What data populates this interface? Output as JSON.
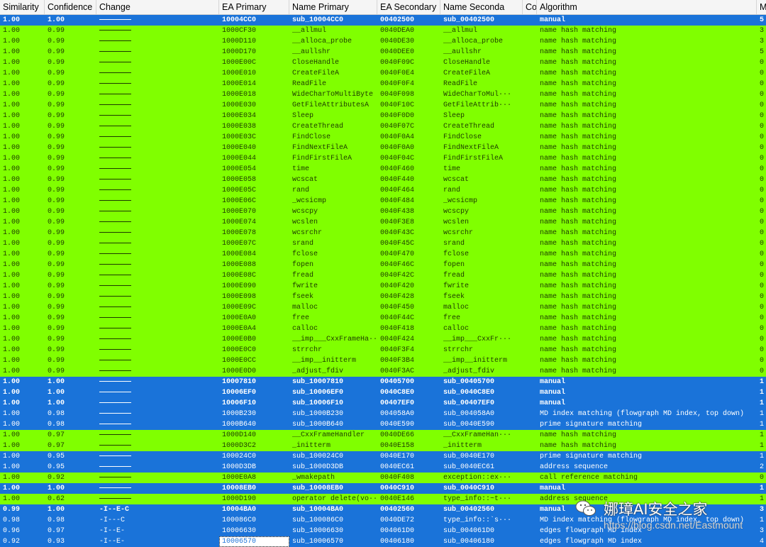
{
  "colors": {
    "green": "#80ff00",
    "blue": "#1a73d9",
    "header": "#f5f5f5"
  },
  "columns": [
    "Similarity",
    "Confidence",
    "Change",
    "EA Primary",
    "Name Primary",
    "EA Secondary",
    "Name Seconda",
    "Co",
    "Algorithm",
    "Matche"
  ],
  "rows": [
    [
      "1.00",
      "1.00",
      "line",
      "10004CC0",
      "sub_10004CC0",
      "00402500",
      "sub_00402500",
      "",
      "manual",
      "5",
      "blue",
      "bold"
    ],
    [
      "1.00",
      "0.99",
      "line",
      "1000CF30",
      "__allmul",
      "0040DEA0",
      "__allmul",
      "",
      "name hash matching",
      "3",
      "green",
      ""
    ],
    [
      "1.00",
      "0.99",
      "line",
      "1000D110",
      "__alloca_probe",
      "0040DE30",
      "__alloca_probe",
      "",
      "name hash matching",
      "3",
      "green",
      ""
    ],
    [
      "1.00",
      "0.99",
      "line",
      "1000D170",
      "__aullshr",
      "0040DEE0",
      "__aullshr",
      "",
      "name hash matching",
      "5",
      "green",
      ""
    ],
    [
      "1.00",
      "0.99",
      "line",
      "1000E00C",
      "CloseHandle",
      "0040F09C",
      "CloseHandle",
      "",
      "name hash matching",
      "0",
      "green",
      ""
    ],
    [
      "1.00",
      "0.99",
      "line",
      "1000E010",
      "CreateFileA",
      "0040F0E4",
      "CreateFileA",
      "",
      "name hash matching",
      "0",
      "green",
      ""
    ],
    [
      "1.00",
      "0.99",
      "line",
      "1000E014",
      "ReadFile",
      "0040F0F4",
      "ReadFile",
      "",
      "name hash matching",
      "0",
      "green",
      ""
    ],
    [
      "1.00",
      "0.99",
      "line",
      "1000E018",
      "WideCharToMultiByte",
      "0040F098",
      "WideCharToMul···",
      "",
      "name hash matching",
      "0",
      "green",
      ""
    ],
    [
      "1.00",
      "0.99",
      "line",
      "1000E030",
      "GetFileAttributesA",
      "0040F10C",
      "GetFileAttrib···",
      "",
      "name hash matching",
      "0",
      "green",
      ""
    ],
    [
      "1.00",
      "0.99",
      "line",
      "1000E034",
      "Sleep",
      "0040F0D0",
      "Sleep",
      "",
      "name hash matching",
      "0",
      "green",
      ""
    ],
    [
      "1.00",
      "0.99",
      "line",
      "1000E038",
      "CreateThread",
      "0040F07C",
      "CreateThread",
      "",
      "name hash matching",
      "0",
      "green",
      ""
    ],
    [
      "1.00",
      "0.99",
      "line",
      "1000E03C",
      "FindClose",
      "0040F0A4",
      "FindClose",
      "",
      "name hash matching",
      "0",
      "green",
      ""
    ],
    [
      "1.00",
      "0.99",
      "line",
      "1000E040",
      "FindNextFileA",
      "0040F0A0",
      "FindNextFileA",
      "",
      "name hash matching",
      "0",
      "green",
      ""
    ],
    [
      "1.00",
      "0.99",
      "line",
      "1000E044",
      "FindFirstFileA",
      "0040F04C",
      "FindFirstFileA",
      "",
      "name hash matching",
      "0",
      "green",
      ""
    ],
    [
      "1.00",
      "0.99",
      "line",
      "1000E054",
      "time",
      "0040F460",
      "time",
      "",
      "name hash matching",
      "0",
      "green",
      ""
    ],
    [
      "1.00",
      "0.99",
      "line",
      "1000E058",
      "wcscat",
      "0040F440",
      "wcscat",
      "",
      "name hash matching",
      "0",
      "green",
      ""
    ],
    [
      "1.00",
      "0.99",
      "line",
      "1000E05C",
      "rand",
      "0040F464",
      "rand",
      "",
      "name hash matching",
      "0",
      "green",
      ""
    ],
    [
      "1.00",
      "0.99",
      "line",
      "1000E06C",
      "_wcsicmp",
      "0040F484",
      "_wcsicmp",
      "",
      "name hash matching",
      "0",
      "green",
      ""
    ],
    [
      "1.00",
      "0.99",
      "line",
      "1000E070",
      "wcscpy",
      "0040F438",
      "wcscpy",
      "",
      "name hash matching",
      "0",
      "green",
      ""
    ],
    [
      "1.00",
      "0.99",
      "line",
      "1000E074",
      "wcslen",
      "0040F3E8",
      "wcslen",
      "",
      "name hash matching",
      "0",
      "green",
      ""
    ],
    [
      "1.00",
      "0.99",
      "line",
      "1000E078",
      "wcsrchr",
      "0040F43C",
      "wcsrchr",
      "",
      "name hash matching",
      "0",
      "green",
      ""
    ],
    [
      "1.00",
      "0.99",
      "line",
      "1000E07C",
      "srand",
      "0040F45C",
      "srand",
      "",
      "name hash matching",
      "0",
      "green",
      ""
    ],
    [
      "1.00",
      "0.99",
      "line",
      "1000E084",
      "fclose",
      "0040F470",
      "fclose",
      "",
      "name hash matching",
      "0",
      "green",
      ""
    ],
    [
      "1.00",
      "0.99",
      "line",
      "1000E088",
      "fopen",
      "0040F46C",
      "fopen",
      "",
      "name hash matching",
      "0",
      "green",
      ""
    ],
    [
      "1.00",
      "0.99",
      "line",
      "1000E08C",
      "fread",
      "0040F42C",
      "fread",
      "",
      "name hash matching",
      "0",
      "green",
      ""
    ],
    [
      "1.00",
      "0.99",
      "line",
      "1000E090",
      "fwrite",
      "0040F420",
      "fwrite",
      "",
      "name hash matching",
      "0",
      "green",
      ""
    ],
    [
      "1.00",
      "0.99",
      "line",
      "1000E098",
      "fseek",
      "0040F428",
      "fseek",
      "",
      "name hash matching",
      "0",
      "green",
      ""
    ],
    [
      "1.00",
      "0.99",
      "line",
      "1000E09C",
      "malloc",
      "0040F450",
      "malloc",
      "",
      "name hash matching",
      "0",
      "green",
      ""
    ],
    [
      "1.00",
      "0.99",
      "line",
      "1000E0A0",
      "free",
      "0040F44C",
      "free",
      "",
      "name hash matching",
      "0",
      "green",
      ""
    ],
    [
      "1.00",
      "0.99",
      "line",
      "1000E0A4",
      "calloc",
      "0040F418",
      "calloc",
      "",
      "name hash matching",
      "0",
      "green",
      ""
    ],
    [
      "1.00",
      "0.99",
      "line",
      "1000E0B0",
      "__imp___CxxFrameHa···",
      "0040F424",
      "__imp___CxxFr···",
      "",
      "name hash matching",
      "0",
      "green",
      ""
    ],
    [
      "1.00",
      "0.99",
      "line",
      "1000E0C0",
      "strrchr",
      "0040F3F4",
      "strrchr",
      "",
      "name hash matching",
      "0",
      "green",
      ""
    ],
    [
      "1.00",
      "0.99",
      "line",
      "1000E0CC",
      "__imp__initterm",
      "0040F3B4",
      "__imp__initterm",
      "",
      "name hash matching",
      "0",
      "green",
      ""
    ],
    [
      "1.00",
      "0.99",
      "line",
      "1000E0D0",
      "_adjust_fdiv",
      "0040F3AC",
      "_adjust_fdiv",
      "",
      "name hash matching",
      "0",
      "green",
      ""
    ],
    [
      "1.00",
      "1.00",
      "line",
      "10007810",
      "sub_10007810",
      "00405700",
      "sub_00405700",
      "",
      "manual",
      "1",
      "blue",
      "bold"
    ],
    [
      "1.00",
      "1.00",
      "line",
      "10006EF0",
      "sub_10006EF0",
      "0040C8E0",
      "sub_0040C8E0",
      "",
      "manual",
      "1",
      "blue",
      "bold"
    ],
    [
      "1.00",
      "1.00",
      "line",
      "10006F10",
      "sub_10006F10",
      "00407EF0",
      "sub_00407EF0",
      "",
      "manual",
      "1",
      "blue",
      "bold"
    ],
    [
      "1.00",
      "0.98",
      "line",
      "1000B230",
      "sub_1000B230",
      "004058A0",
      "sub_004058A0",
      "",
      "MD index matching (flowgraph MD index, top down)",
      "1",
      "blue",
      ""
    ],
    [
      "1.00",
      "0.98",
      "line",
      "1000B640",
      "sub_1000B640",
      "0040E590",
      "sub_0040E590",
      "",
      "prime signature matching",
      "1",
      "blue",
      ""
    ],
    [
      "1.00",
      "0.97",
      "line",
      "1000D140",
      "__CxxFrameHandler",
      "0040DE66",
      "__CxxFrameHan···",
      "",
      "name hash matching",
      "1",
      "green",
      ""
    ],
    [
      "1.00",
      "0.97",
      "line",
      "1000D3C2",
      "_initterm",
      "0040E158",
      "_initterm",
      "",
      "name hash matching",
      "1",
      "green",
      ""
    ],
    [
      "1.00",
      "0.95",
      "line",
      "100024C0",
      "sub_100024C0",
      "0040E170",
      "sub_0040E170",
      "",
      "prime signature matching",
      "1",
      "blue",
      ""
    ],
    [
      "1.00",
      "0.95",
      "line",
      "1000D3DB",
      "sub_1000D3DB",
      "0040EC61",
      "sub_0040EC61",
      "",
      "address sequence",
      "2",
      "blue",
      ""
    ],
    [
      "1.00",
      "0.92",
      "line",
      "1000E0A8",
      "_wmakepath",
      "0040F408",
      "exception::ex···",
      "",
      "call reference matching",
      "0",
      "green",
      ""
    ],
    [
      "1.00",
      "1.00",
      "line",
      "10008EB0",
      "sub_10008EB0",
      "0040C910",
      "sub_0040C910",
      "",
      "manual",
      "1",
      "blue",
      "bold"
    ],
    [
      "1.00",
      "0.62",
      "line",
      "1000D190",
      "operator delete(vo···",
      "0040E146",
      "type_info::~t···",
      "",
      "address sequence",
      "1",
      "green",
      ""
    ],
    [
      "0.99",
      "1.00",
      "-I--E-C",
      "10004BA0",
      "sub_10004BA0",
      "00402560",
      "sub_00402560",
      "",
      "manual",
      "3",
      "blue",
      "bold"
    ],
    [
      "0.98",
      "0.98",
      "-I---C",
      "100086C0",
      "sub_100086C0",
      "0040DE72",
      "type_info::`s···",
      "",
      "MD index matching (flowgraph MD index, top down)",
      "1",
      "blue",
      ""
    ],
    [
      "0.96",
      "0.97",
      "-I--E-",
      "10006630",
      "sub_10006630",
      "004061D0",
      "sub_004061D0",
      "",
      "edges flowgraph MD index",
      "3",
      "blue",
      ""
    ],
    [
      "0.92",
      "0.93",
      "-I--E-",
      "10006570",
      "sub_10006570",
      "00406180",
      "sub_00406180",
      "",
      "edges flowgraph MD index",
      "4",
      "blue",
      "selected"
    ]
  ],
  "watermark": {
    "name": "娜璋AI安全之家",
    "url": "https://blog.csdn.net/Eastmount",
    "icon": "wechat-icon"
  }
}
